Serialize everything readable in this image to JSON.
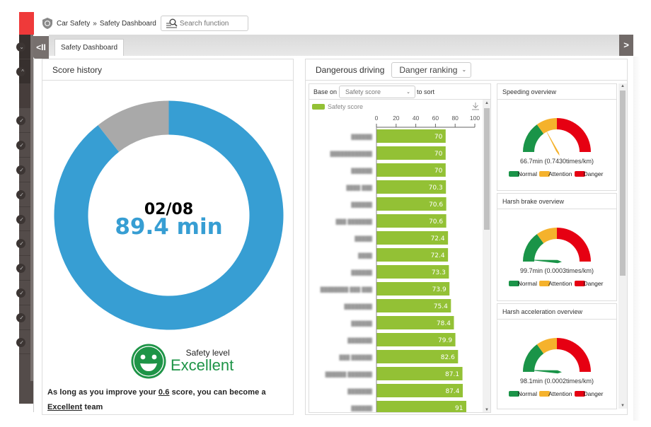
{
  "topbar": {
    "breadcrumb": [
      "Car Safety",
      "Safety Dashboard"
    ],
    "breadcrumb_separator": "»",
    "search_placeholder": "Search function",
    "icons": {
      "app": "shield-icon",
      "search": "search-list-icon"
    }
  },
  "tabs": [
    {
      "label": "Safety Dashboard",
      "active": true
    }
  ],
  "controls": {
    "collapse_label": "<II",
    "next_label": ">"
  },
  "left_nav": {
    "item_count": 13,
    "icon": "chevron-icon"
  },
  "score_history": {
    "title": "Score history",
    "date": "02/08",
    "value_label": "89.4 min",
    "value": 89.4,
    "max": 100,
    "colors": {
      "value": "#379ed3",
      "remainder": "#a9a9a9"
    },
    "safety_level_label": "Safety level",
    "safety_level": "Excellent",
    "safety_level_color": "#1e9447",
    "advice": {
      "prefix": "As long as you improve your ",
      "score": "0.6",
      "middle": " score, you can become a ",
      "level": "Excellent",
      "suffix": " team"
    }
  },
  "dangerous_driving": {
    "title": "Dangerous driving",
    "mode_select": "Danger ranking",
    "sort_prefix": "Base on",
    "sort_select": "Safety score",
    "sort_suffix": "to sort"
  },
  "chart_data": {
    "type": "bar",
    "orientation": "horizontal",
    "title": "",
    "legend": [
      "Safety score"
    ],
    "legend_position": "top-left",
    "xlabel": "",
    "ylabel": "",
    "xlim": [
      0,
      100
    ],
    "x_ticks": [
      0,
      20,
      40,
      60,
      80,
      100
    ],
    "bar_color": "#93c135",
    "categories": [
      "██████",
      "████████████",
      "██████",
      "████ ███",
      "██████",
      "███ ███████",
      "█████",
      "████",
      "██████",
      "████████ ███ ███",
      "████████",
      "██████",
      "███████",
      "███ ██████",
      "██████ ███████",
      "███████",
      "██████"
    ],
    "categories_obscured": true,
    "values": [
      70,
      70,
      70,
      70.3,
      70.6,
      70.6,
      72.4,
      72.4,
      73.3,
      73.9,
      75.4,
      78.4,
      79.9,
      82.6,
      87.1,
      87.4,
      91
    ]
  },
  "gauges": [
    {
      "title": "Speeding overview",
      "reading": "66.7min (0.7430times/km)",
      "needle_fraction": 0.35
    },
    {
      "title": "Harsh brake overview",
      "reading": "99.7min (0.0003times/km)",
      "needle_fraction": 0.02
    },
    {
      "title": "Harsh acceleration overview",
      "reading": "98.1min (0.0002times/km)",
      "needle_fraction": 0.02
    }
  ],
  "gauge_legend": [
    {
      "label": "Normal",
      "color": "#1a9448"
    },
    {
      "label": "Attention",
      "color": "#f5b22c"
    },
    {
      "label": "Danger",
      "color": "#e60012"
    }
  ]
}
